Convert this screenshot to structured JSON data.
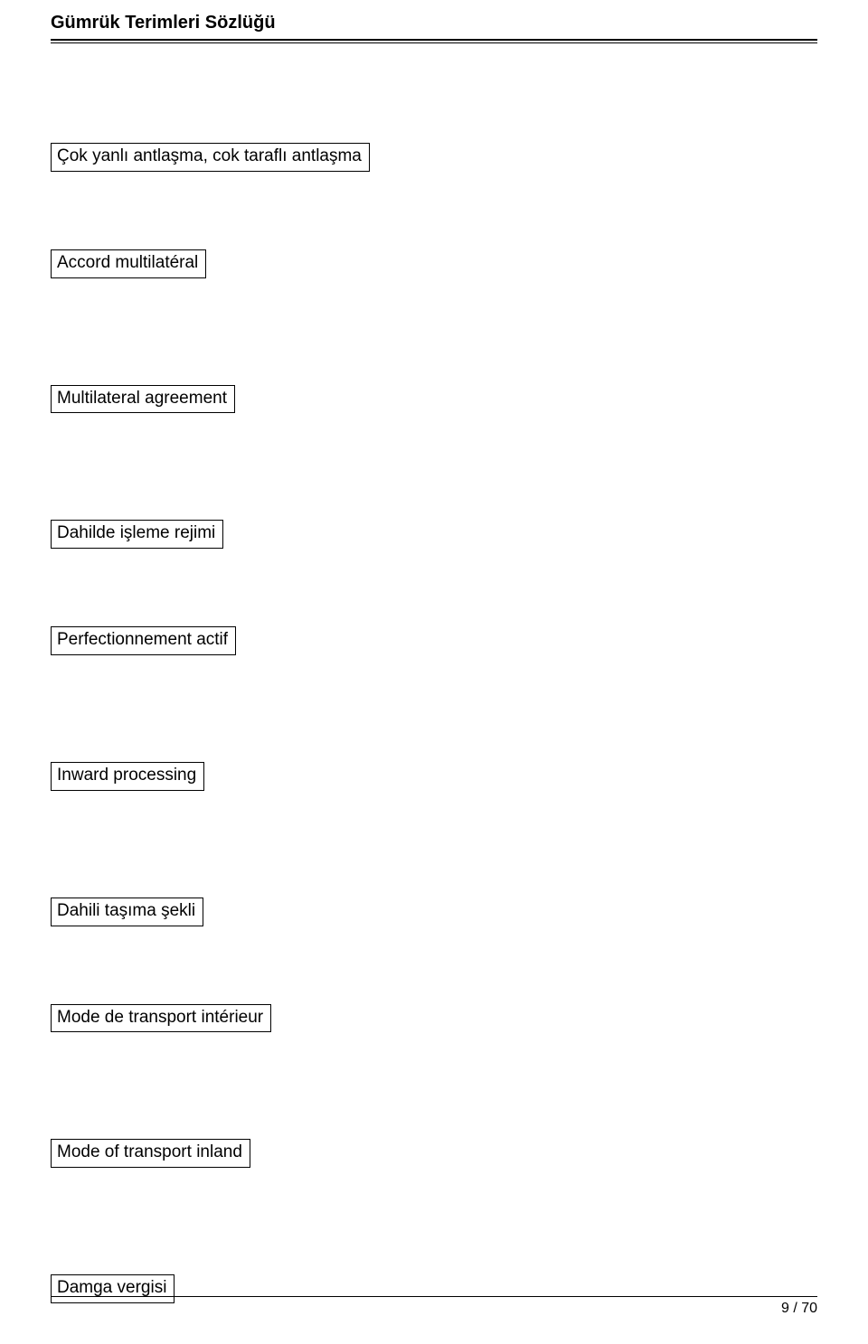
{
  "header": {
    "title": "Gümrük Terimleri Sözlüğü"
  },
  "terms": [
    "Çok yanlı antlaşma, cok taraflı antlaşma",
    "Accord multilatéral",
    "Multilateral agreement",
    "Dahilde işleme rejimi",
    "Perfectionnement actif",
    "Inward processing",
    "Dahili taşıma şekli",
    "Mode de transport intérieur",
    "Mode of transport inland",
    "Damga vergisi"
  ],
  "footer": {
    "page": "9 / 70"
  }
}
